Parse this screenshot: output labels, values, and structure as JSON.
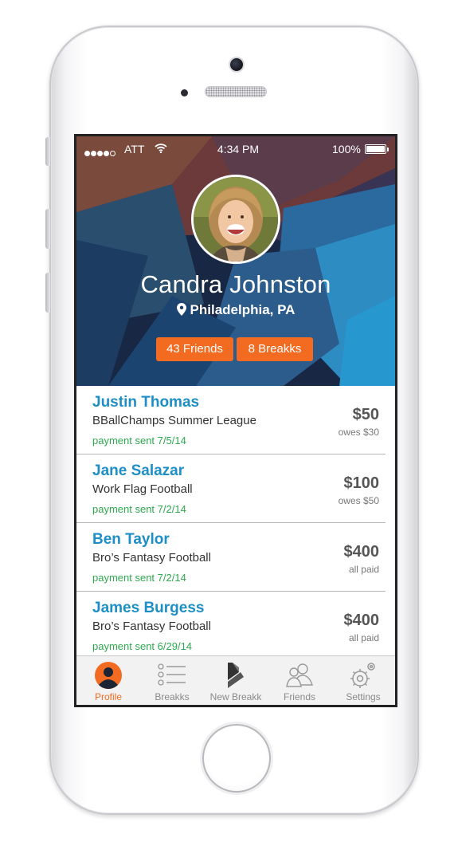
{
  "status_bar": {
    "carrier": "ATT",
    "time": "4:34 PM",
    "battery": "100%"
  },
  "profile": {
    "name": "Candra Johnston",
    "location": "Philadelphia, PA",
    "friends_button": "43 Friends",
    "breakks_button": "8 Breakks"
  },
  "transactions": [
    {
      "name": "Justin Thomas",
      "league": "BBallChamps Summer League",
      "status": "payment sent 7/5/14",
      "amount": "$50",
      "note": "owes $30"
    },
    {
      "name": "Jane Salazar",
      "league": "Work Flag Football",
      "status": "payment sent 7/2/14",
      "amount": "$100",
      "note": "owes $50"
    },
    {
      "name": "Ben Taylor",
      "league": "Bro’s Fantasy Football",
      "status": "payment sent 7/2/14",
      "amount": "$400",
      "note": "all paid"
    },
    {
      "name": "James Burgess",
      "league": "Bro’s Fantasy Football",
      "status": "payment sent 6/29/14",
      "amount": "$400",
      "note": "all paid"
    }
  ],
  "tabs": [
    {
      "label": "Profile",
      "icon": "person-icon",
      "active": true
    },
    {
      "label": "Breakks",
      "icon": "list-icon"
    },
    {
      "label": "New Breakk",
      "icon": "breakk-logo-icon"
    },
    {
      "label": "Friends",
      "icon": "friends-icon"
    },
    {
      "label": "Settings",
      "icon": "gear-icon"
    }
  ],
  "colors": {
    "accent_orange": "#f26b21",
    "name_blue": "#1d8fc6",
    "payment_green": "#2fa84f"
  }
}
